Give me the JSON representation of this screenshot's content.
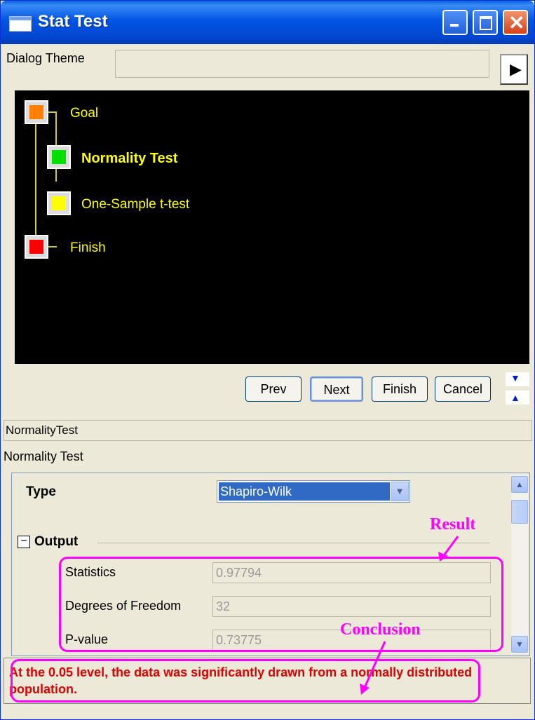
{
  "window": {
    "title": "Stat Test"
  },
  "dialog_theme": {
    "label": "Dialog Theme",
    "value": ""
  },
  "tree": {
    "nodes": [
      {
        "label": "Goal",
        "color": "#ff8000"
      },
      {
        "label": "Normality Test",
        "color": "#00e000"
      },
      {
        "label": "One-Sample t-test",
        "color": "#ffff00"
      },
      {
        "label": "Finish",
        "color": "#ff0000"
      }
    ]
  },
  "buttons": {
    "prev": "Prev",
    "next": "Next",
    "finish": "Finish",
    "cancel": "Cancel"
  },
  "step": {
    "path": "NormalityTest",
    "title": "Normality Test"
  },
  "properties": {
    "type_label": "Type",
    "type_value": "Shapiro-Wilk",
    "output_label": "Output",
    "statistics_label": "Statistics",
    "statistics_value": "0.97794",
    "dof_label": "Degrees of Freedom",
    "dof_value": "32",
    "pvalue_label": "P-value",
    "pvalue_value": "0.73775"
  },
  "conclusion": "At the 0.05 level, the data was significantly drawn from a normally distributed population.",
  "annotations": {
    "result": "Result",
    "conclusion": "Conclusion"
  }
}
